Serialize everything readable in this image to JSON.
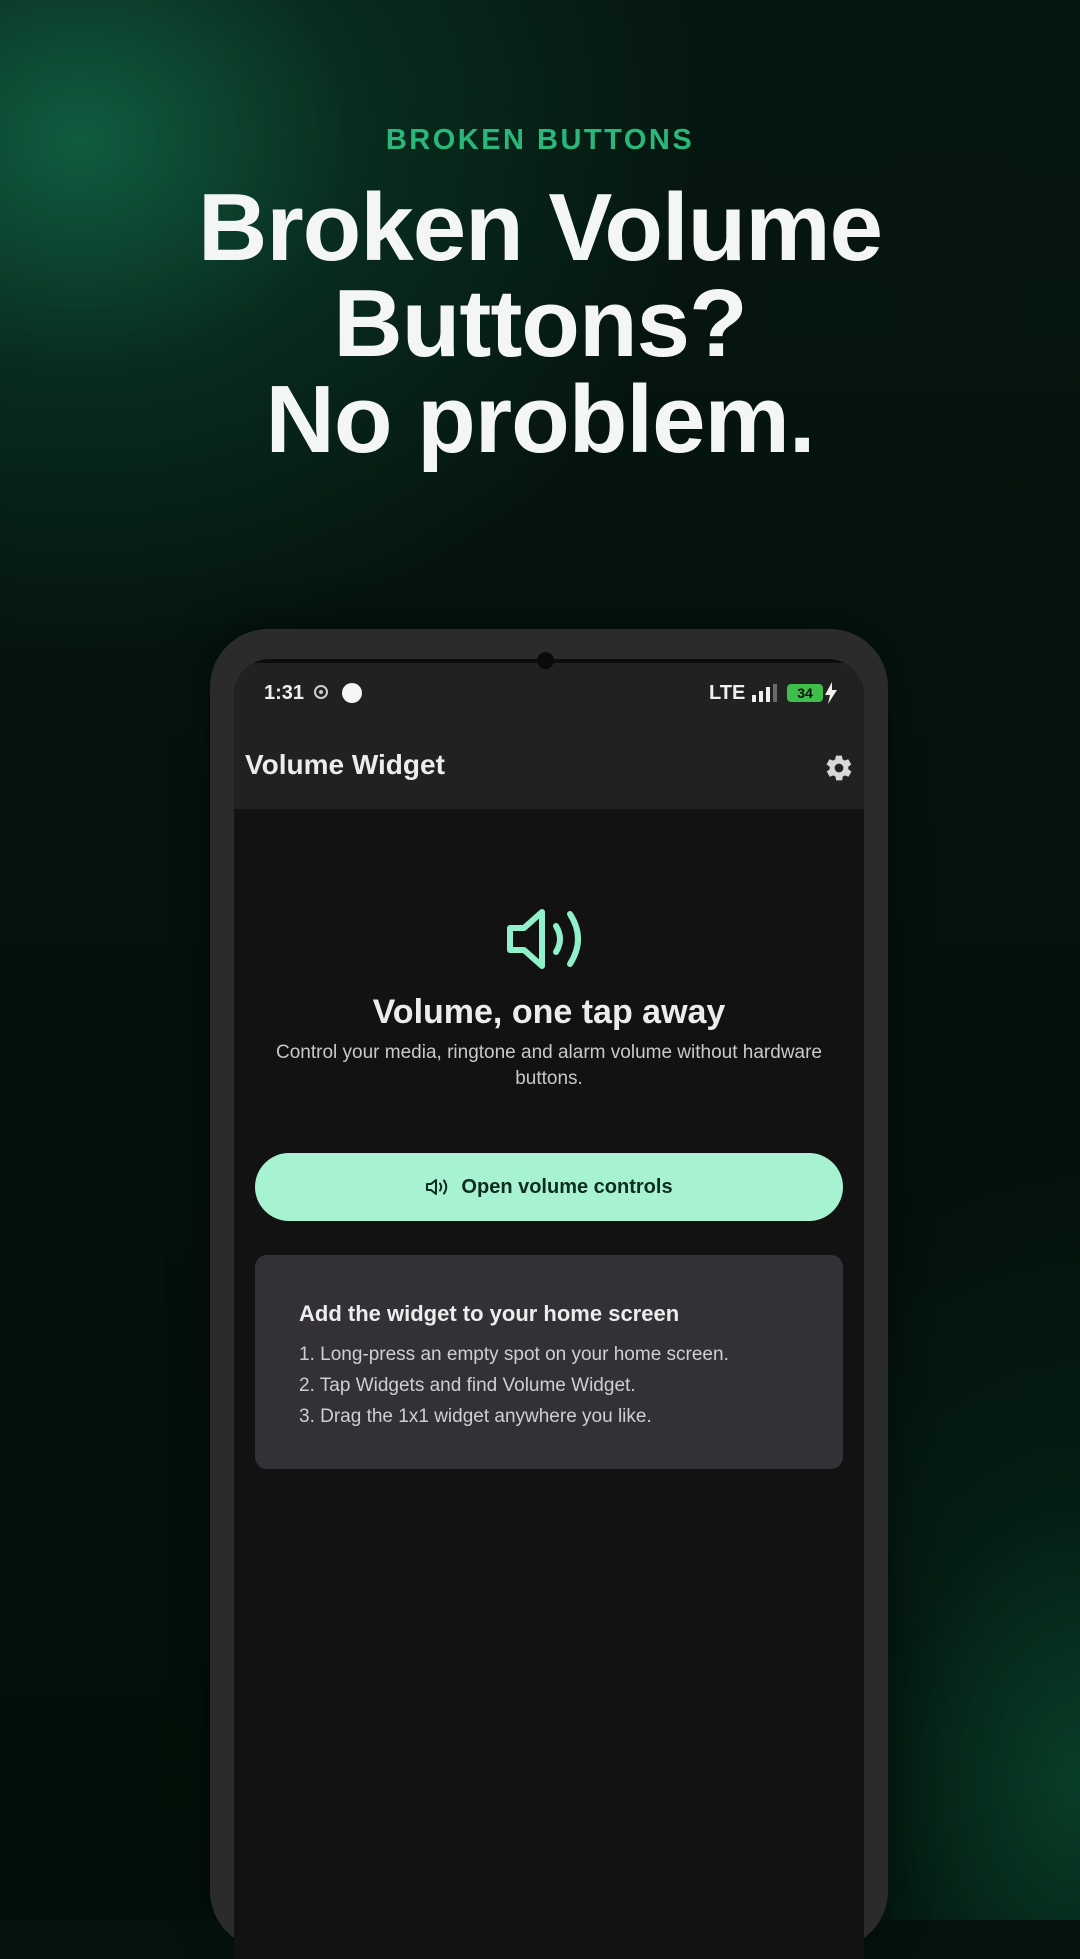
{
  "marketing": {
    "eyebrow": "BROKEN BUTTONS",
    "headline_lines": [
      "Broken Volume",
      "Buttons?",
      "No problem."
    ]
  },
  "status_bar": {
    "time": "1:31",
    "network": "LTE",
    "battery": "34"
  },
  "app_bar": {
    "title": "Volume Widget",
    "settings_icon": "gear-icon"
  },
  "hero": {
    "icon": "speaker-icon",
    "title": "Volume, one tap away",
    "subtitle": "Control your media, ringtone and alarm volume without hardware buttons."
  },
  "primary_button": {
    "icon": "speaker-icon",
    "label": "Open volume controls"
  },
  "instructions": {
    "title": "Add the widget to your home screen",
    "steps": [
      "1. Long-press an empty spot on your home screen.",
      "2. Tap Widgets and find Volume Widget.",
      "3. Drag the 1x1 widget anywhere you like."
    ]
  },
  "colors": {
    "accent": "#29b87a",
    "button_bg": "#a7f3d1",
    "icon_accent": "#8ff0c9",
    "screen_bg": "#121212",
    "card_bg": "#333135"
  }
}
